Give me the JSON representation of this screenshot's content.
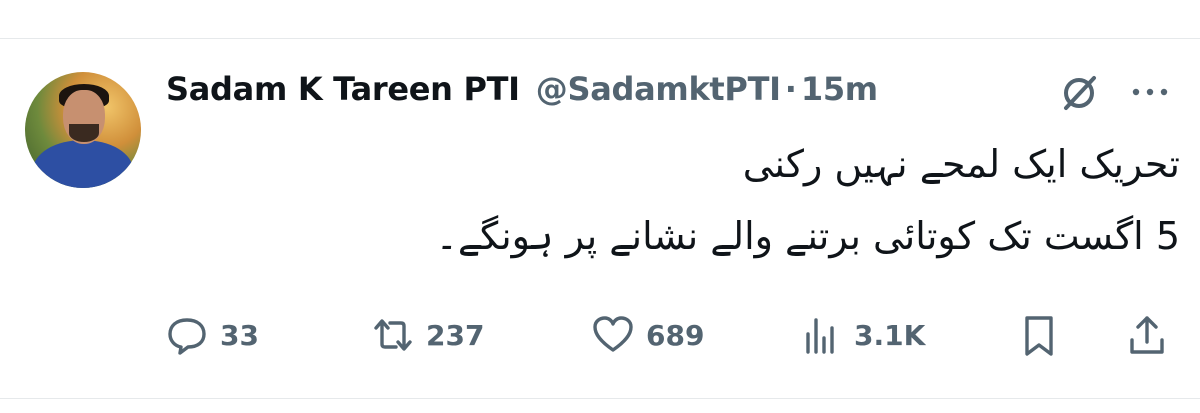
{
  "tweet": {
    "display_name": "Sadam K Tareen PTI",
    "handle": "@SadamktPTI",
    "separator": "·",
    "time": "15m",
    "text_lines": [
      "تحریک ایک لمحے نہیں رکنی",
      "5 اگست تک کوتائی برتنے والے نشانے پر ہونگے۔"
    ]
  },
  "actions": {
    "replies": "33",
    "reposts": "237",
    "likes": "689",
    "views": "3.1K"
  },
  "icons": {
    "grok": "grok-icon",
    "more": "more-icon",
    "reply": "reply-icon",
    "repost": "repost-icon",
    "like": "heart-icon",
    "views": "views-icon",
    "bookmark": "bookmark-icon",
    "share": "share-icon"
  },
  "colors": {
    "text_primary": "#0f1419",
    "text_secondary": "#536471",
    "divider": "#e6e9eb"
  }
}
